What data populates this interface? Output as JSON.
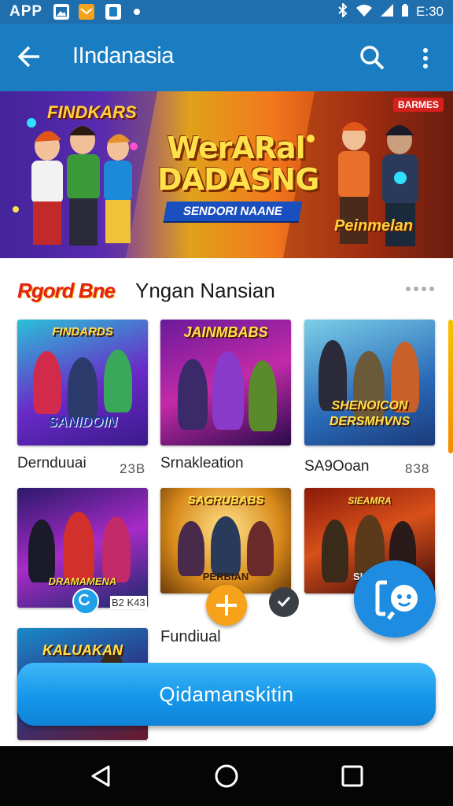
{
  "status_bar": {
    "app_label": "APP",
    "time": "E:30",
    "icons": [
      "gallery-icon",
      "mail-icon",
      "app-icon",
      "notification-dot-icon",
      "bluetooth-icon",
      "wifi-icon",
      "signal-icon",
      "battery-icon"
    ]
  },
  "app_bar": {
    "title": "IIndanasia",
    "icons": [
      "back-arrow-icon",
      "search-icon",
      "more-vertical-icon"
    ]
  },
  "banner": {
    "left_title": "FINDKARS",
    "title_line1": "WerARal",
    "title_line2": "DADASNG",
    "subtitle": "SENDORI NAANE",
    "badge": "BARMES",
    "right_title": "Peinmelan"
  },
  "section": {
    "accent_label": "Rgord Bne",
    "title": "Yngan Nansian"
  },
  "games": [
    {
      "tile_title": "FINDARDS",
      "tile_sub": "SANIDOIN",
      "name": "Dernduuai",
      "count": "23B"
    },
    {
      "tile_title": "JAINMBABS",
      "tile_sub": "",
      "name": "Srnakleation",
      "count": ""
    },
    {
      "tile_title": "",
      "tile_sub": "SHENOICON DERSMHVNS",
      "name": "SA9Ooan",
      "count": "838"
    },
    {
      "tile_title": "",
      "tile_sub": "DRAMAMENA",
      "name": "",
      "count": ""
    },
    {
      "tile_title": "SAGRUBABS",
      "tile_sub": "PERBIAN",
      "name": "",
      "count": ""
    },
    {
      "tile_title": "SIEAMRA",
      "tile_sub": "SIONO",
      "name": "",
      "count": ""
    },
    {
      "tile_title": "KALUAKAN",
      "tile_sub": "",
      "name": "",
      "count": ""
    }
  ],
  "overlays": {
    "small_tag": "B2 K43",
    "below_name": "Fundiual"
  },
  "cta": {
    "label": "Qidamanskitin"
  },
  "nav": {
    "icons": [
      "nav-back-icon",
      "nav-home-icon",
      "nav-recents-icon"
    ]
  },
  "colors": {
    "status_bar": "#1f6fae",
    "app_bar": "#1a7dc2",
    "cta_blue": "#1596ea",
    "accent_red": "#e2221a",
    "fab_orange": "#f7a21b",
    "chat_fab": "#1e8ce0",
    "nav_bar": "#050505"
  }
}
